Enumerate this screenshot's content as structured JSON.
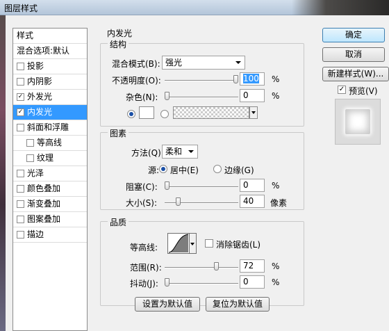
{
  "window": {
    "title": "图层样式"
  },
  "style_list": {
    "header": "样式",
    "blend_default": "混合选项:默认",
    "items": [
      {
        "label": "投影",
        "checked": false
      },
      {
        "label": "内阴影",
        "checked": false
      },
      {
        "label": "外发光",
        "checked": true
      },
      {
        "label": "内发光",
        "checked": true,
        "selected": true
      },
      {
        "label": "斜面和浮雕",
        "checked": false
      },
      {
        "label": "等高线",
        "checked": false
      },
      {
        "label": "纹理",
        "checked": false
      },
      {
        "label": "光泽",
        "checked": false
      },
      {
        "label": "颜色叠加",
        "checked": false
      },
      {
        "label": "渐变叠加",
        "checked": false
      },
      {
        "label": "图案叠加",
        "checked": false
      },
      {
        "label": "描边",
        "checked": false
      }
    ],
    "check_mark": "✓"
  },
  "panel": {
    "title": "内发光",
    "structure": {
      "legend": "结构",
      "blend_mode_label": "混合模式(B):",
      "blend_mode_value": "强光",
      "opacity_label": "不透明度(O):",
      "opacity_value": "100",
      "opacity_unit": "%",
      "opacity_level": 1.0,
      "noise_label": "杂色(N):",
      "noise_value": "0",
      "noise_unit": "%",
      "noise_level": 0.0
    },
    "elements": {
      "legend": "图素",
      "method_label": "方法(Q):",
      "method_value": "柔和",
      "source_label": "源:",
      "source_center": "居中(E)",
      "source_edge": "边缘(G)",
      "choke_label": "阻塞(C):",
      "choke_value": "0",
      "choke_unit": "%",
      "choke_level": 0.0,
      "size_label": "大小(S):",
      "size_value": "40",
      "size_unit": "像素",
      "size_level": 0.16
    },
    "quality": {
      "legend": "品质",
      "contour_label": "等高线:",
      "antialias_label": "消除锯齿(L)",
      "range_label": "范围(R):",
      "range_value": "72",
      "range_unit": "%",
      "range_level": 0.72,
      "jitter_label": "抖动(J):",
      "jitter_value": "0",
      "jitter_unit": "%",
      "jitter_level": 0.0
    },
    "make_default": "设置为默认值",
    "reset_default": "复位为默认值"
  },
  "buttons": {
    "ok": "确定",
    "cancel": "取消",
    "new_style": "新建样式(W)...",
    "preview_label": "预览(V)",
    "preview_checked": true
  },
  "colors": {
    "selection": "#3399ff",
    "dialog_bg": "#f0f0f0"
  }
}
